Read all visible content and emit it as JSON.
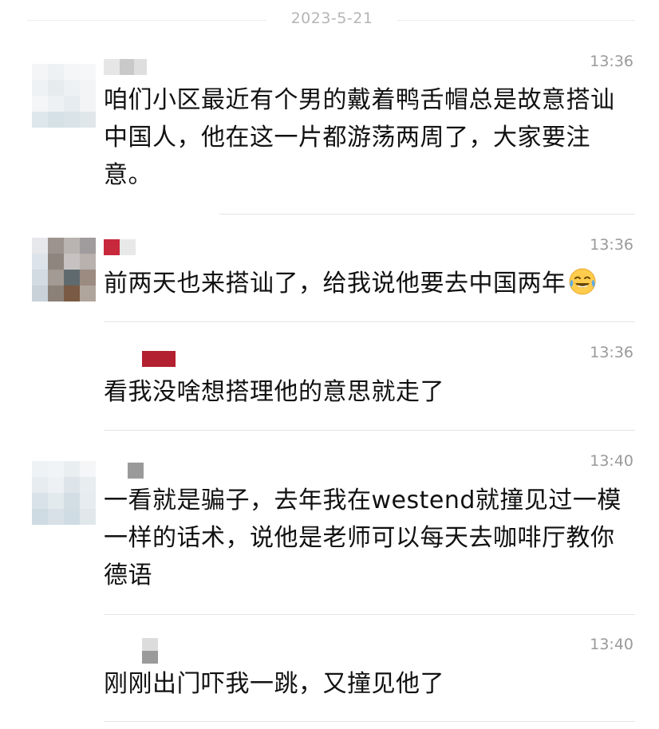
{
  "date_divider": "2023-5-21",
  "messages": [
    {
      "time": "13:36",
      "text": "咱们小区最近有个男的戴着鸭舌帽总是故意搭讪中国人，他在这一片都游荡两周了，大家要注意。"
    },
    {
      "time": "13:36",
      "text": "前两天也来搭讪了，给我说他要去中国两年",
      "emoji": "laughing-crying-face-icon"
    },
    {
      "time": "13:36",
      "text": "看我没啥想搭理他的意思就走了"
    },
    {
      "time": "13:40",
      "text": "一看就是骗子，去年我在westend就撞见过一模一样的话术，说他是老师可以每天去咖啡厅教你德语"
    },
    {
      "time": "13:40",
      "text": "刚刚出门吓我一跳，又撞见他了"
    }
  ],
  "colors": {
    "name_red": "#c8283c",
    "time_gray": "#9a9a9a",
    "text": "#111111"
  }
}
